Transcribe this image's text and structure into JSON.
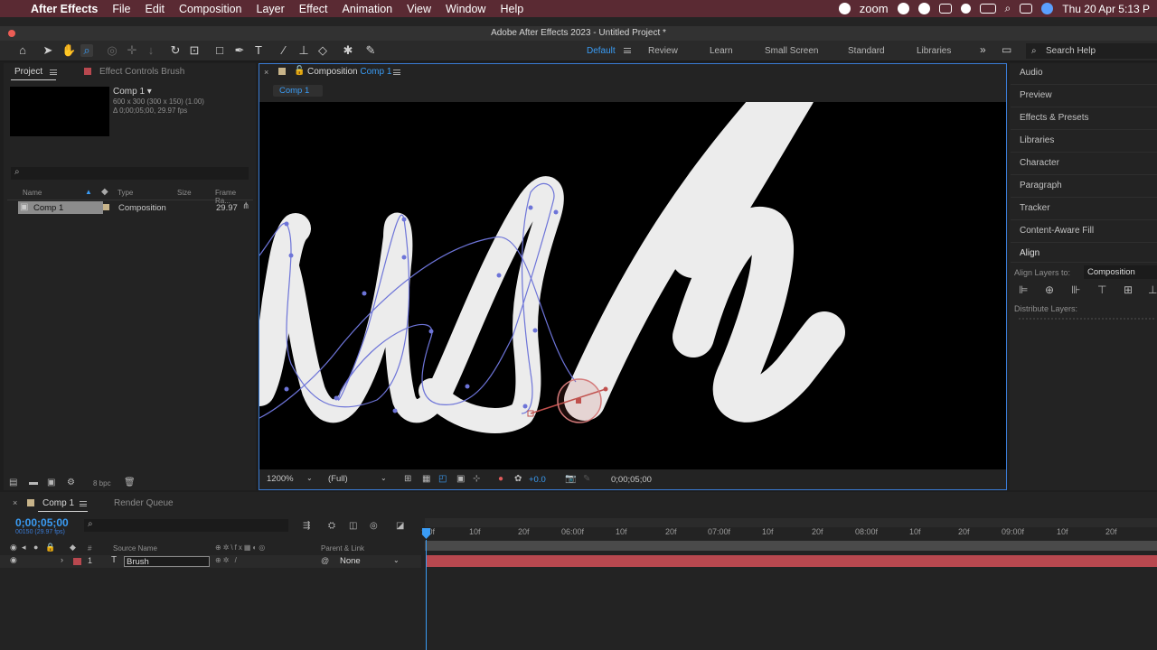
{
  "menubar": {
    "apple": "",
    "app_name": "After Effects",
    "items": [
      "File",
      "Edit",
      "Composition",
      "Layer",
      "Effect",
      "Animation",
      "View",
      "Window",
      "Help"
    ],
    "zoom": "zoom",
    "datetime": "Thu 20 Apr  5:13 P"
  },
  "window": {
    "title": "Adobe After Effects 2023 - Untitled Project *"
  },
  "workspaces": {
    "items": [
      "Default",
      "Review",
      "Learn",
      "Small Screen",
      "Standard",
      "Libraries"
    ],
    "active": "Default",
    "search_placeholder": "Search Help"
  },
  "project_panel": {
    "tab_project": "Project",
    "tab_effect_controls": "Effect Controls Brush",
    "comp_name": "Comp 1 ▾",
    "comp_dims": "600 x 300  (300 x 150) (1.00)",
    "comp_duration": "Δ 0;00;05;00, 29.97 fps",
    "columns": {
      "name": "Name",
      "type": "Type",
      "size": "Size",
      "frame_rate": "Frame Ra..."
    },
    "rows": [
      {
        "name": "Comp 1",
        "type": "Composition",
        "frame_rate": "29.97"
      }
    ],
    "bpc": "8 bpc"
  },
  "composition_panel": {
    "tab_label": "Composition",
    "tab_comp": "Comp 1",
    "breadcrumb": "Comp 1",
    "zoom_level": "1200%",
    "resolution": "(Full)",
    "exposure": "+0.0",
    "timecode": "0;00;05;00"
  },
  "right_panel": {
    "items": [
      "Audio",
      "Preview",
      "Effects & Presets",
      "Libraries",
      "Character",
      "Paragraph",
      "Tracker",
      "Content-Aware Fill"
    ],
    "align_title": "Align",
    "align_layers_to": "Align Layers to:",
    "align_target": "Composition",
    "distribute_layers": "Distribute Layers:"
  },
  "timeline": {
    "tab_comp": "Comp 1",
    "tab_render": "Render Queue",
    "current_time": "0;00;05;00",
    "current_frame": "00150 (29.97 fps)",
    "columns": {
      "num": "#",
      "source_name": "Source Name",
      "parent": "Parent & Link"
    },
    "layers": [
      {
        "index": "1",
        "type_icon": "T",
        "name": "Brush",
        "parent": "None"
      }
    ],
    "ruler": [
      ":00f",
      "10f",
      "20f",
      "06:00f",
      "10f",
      "20f",
      "07:00f",
      "10f",
      "20f",
      "08:00f",
      "10f",
      "20f",
      "09:00f",
      "10f",
      "20f"
    ]
  },
  "colors": {
    "menubar_bg": "#5a2a33",
    "accent_blue": "#3a9cf5",
    "layer_bar": "#b8484f",
    "path_stroke": "#6d74d8"
  }
}
